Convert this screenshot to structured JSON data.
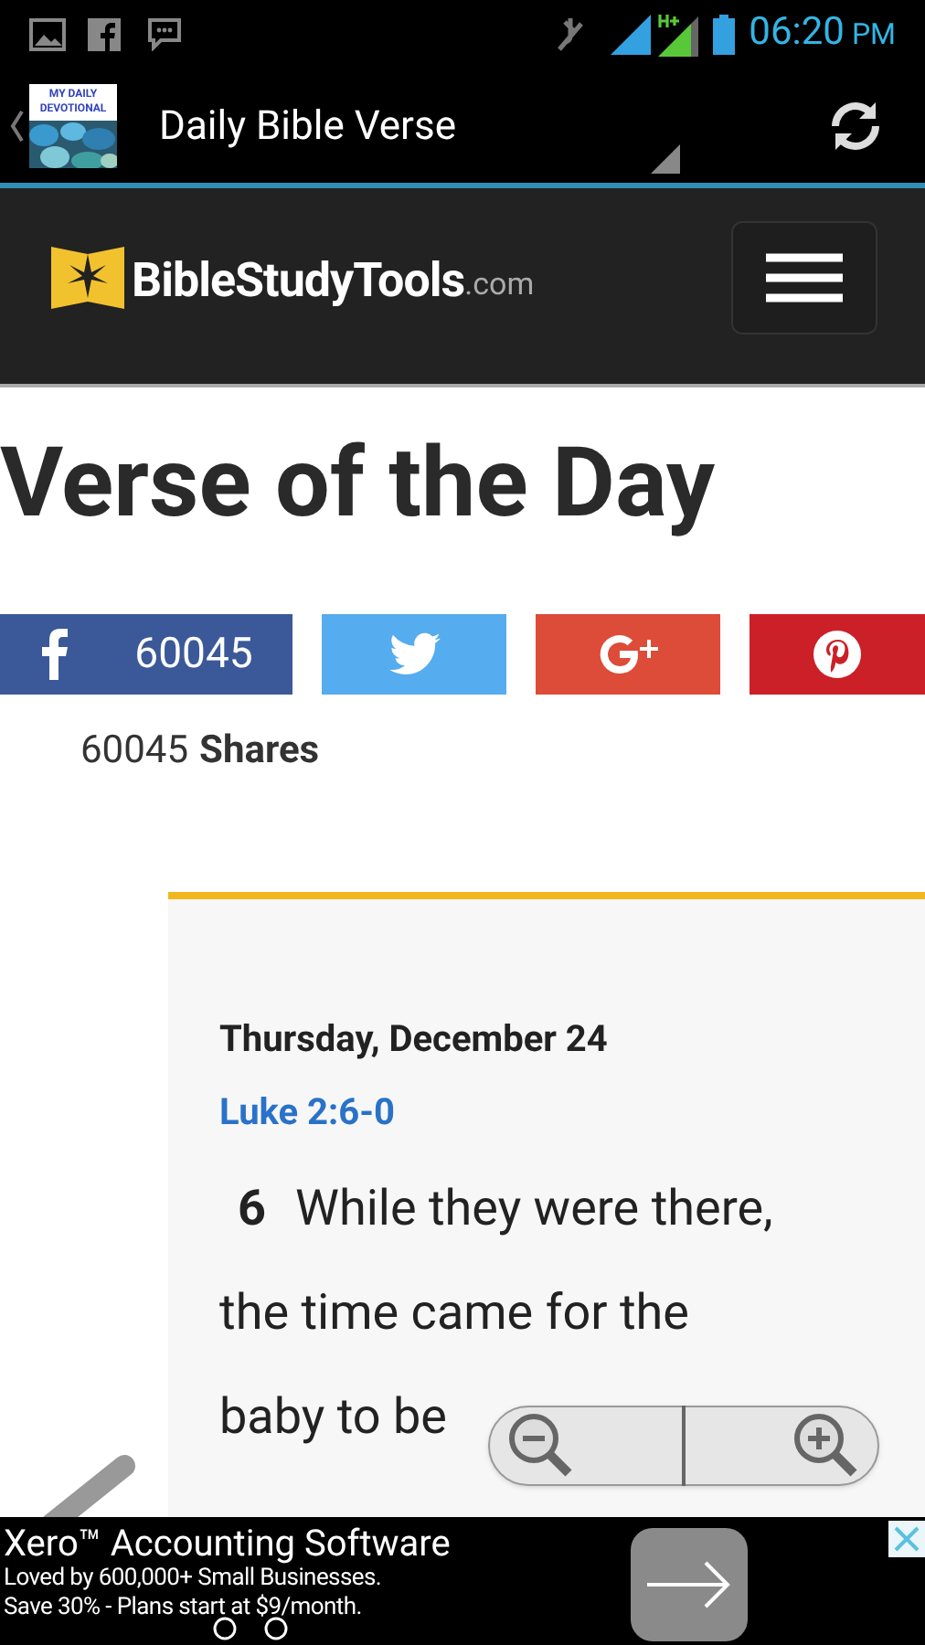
{
  "status_bar": {
    "time": "06:20",
    "meridiem": "PM"
  },
  "action_bar": {
    "app_icon_label": "MY DAILY DEVOTIONAL",
    "title": "Daily Bible Verse"
  },
  "site_header": {
    "logo_name": "BibleStudyTools",
    "logo_suffix": ".com"
  },
  "page_title": "Verse of the Day",
  "share_buttons": [
    {
      "kind": "facebook",
      "count": "60045",
      "color": "#3b5998"
    },
    {
      "kind": "twitter",
      "color": "#55acee"
    },
    {
      "kind": "googleplus",
      "color": "#dd4b39"
    },
    {
      "kind": "pinterest",
      "color": "#cb2027"
    }
  ],
  "share_total": {
    "count": "60045",
    "label": "Shares"
  },
  "verse_card": {
    "date": "Thursday, December 24",
    "reference": "Luke 2:6-0",
    "verse_number": "6",
    "lines": [
      "While they were there,",
      "the time came for the",
      "baby to be"
    ]
  },
  "ad": {
    "title": "Xero™ Accounting Software",
    "lines": [
      "Loved by 600,000+ Small Businesses.",
      "Save 30% - Plans start at $9/month."
    ]
  }
}
